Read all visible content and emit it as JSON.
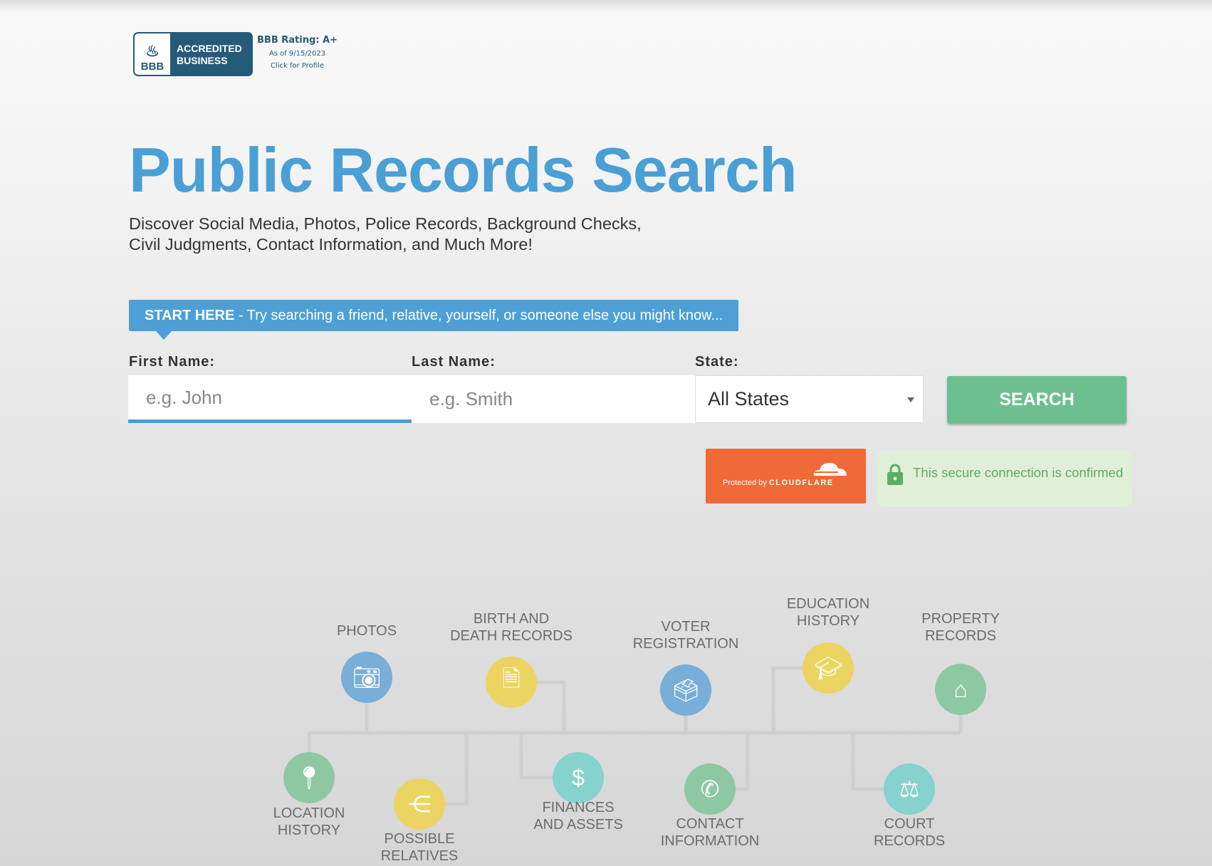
{
  "bbb": {
    "logo_top": "BBB",
    "logo_line1": "ACCREDITED",
    "logo_line2": "BUSINESS",
    "rating": "BBB Rating: A+",
    "as_of": "As of 9/15/2023",
    "profile_link": "Click for Profile"
  },
  "title": "Public Records Search",
  "subtitle_line1": "Discover Social Media, Photos, Police Records, Background Checks,",
  "subtitle_line2": "Civil Judgments, Contact Information, and Much More!",
  "banner": {
    "strong": "START HERE",
    "text": " - Try searching a friend, relative, yourself, or someone else you might know..."
  },
  "form": {
    "first_label": "First Name:",
    "first_placeholder": "e.g. John",
    "first_value": "",
    "last_label": "Last Name:",
    "last_placeholder": "e.g. Smith",
    "last_value": "",
    "state_label": "State:",
    "state_selected": "All States",
    "search_label": "SEARCH"
  },
  "cloudflare": {
    "prefix": "Protected by ",
    "brand": "CLOUDFLARE"
  },
  "secure": {
    "text": "This secure connection is confirmed"
  },
  "colors": {
    "accent": "#4a9fd5",
    "search": "#6dbf8f",
    "cloudflare": "#ef6a37",
    "secure_text": "#5aae62",
    "blue": "#78aed8",
    "yellow": "#ecd462",
    "green": "#8ec8a3",
    "teal": "#86d2cf"
  },
  "categories": [
    {
      "label1": "Photos",
      "label2": "",
      "icon": "camera-icon",
      "color": "#78aed8"
    },
    {
      "label1": "Birth and",
      "label2": "Death Records",
      "icon": "documents-icon",
      "color": "#ecd462"
    },
    {
      "label1": "Voter",
      "label2": "Registration",
      "icon": "ballot-icon",
      "color": "#78aed8"
    },
    {
      "label1": "Education",
      "label2": "History",
      "icon": "graduation-cap-icon",
      "color": "#ecd462"
    },
    {
      "label1": "Property",
      "label2": "Records",
      "icon": "house-icon",
      "color": "#8ec8a3"
    },
    {
      "label1": "Location",
      "label2": "History",
      "icon": "map-pin-icon",
      "color": "#8ec8a3"
    },
    {
      "label1": "Possible",
      "label2": "Relatives",
      "icon": "share-network-icon",
      "color": "#ecd462"
    },
    {
      "label1": "Finances",
      "label2": "and Assets",
      "icon": "money-icon",
      "color": "#86d2cf"
    },
    {
      "label1": "Contact",
      "label2": "Information",
      "icon": "phone-icon",
      "color": "#8ec8a3"
    },
    {
      "label1": "Court",
      "label2": "Records",
      "icon": "gavel-icon",
      "color": "#86d2cf"
    }
  ]
}
